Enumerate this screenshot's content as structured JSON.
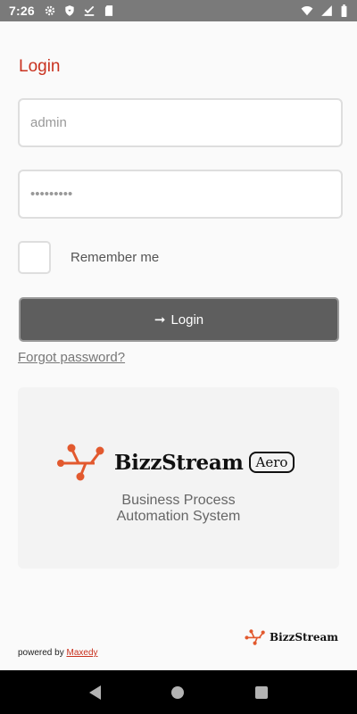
{
  "status_bar": {
    "time": "7:26",
    "left_icons": [
      "gear-icon",
      "shield-icon",
      "download-check-icon",
      "sd-card-icon"
    ],
    "right_icons": [
      "wifi-icon",
      "signal-icon",
      "battery-icon"
    ]
  },
  "login": {
    "title": "Login",
    "username_value": "admin",
    "password_value": "•••••••••",
    "remember_label": "Remember me",
    "button_label": "Login",
    "forgot_label": "Forgot password?"
  },
  "brand": {
    "name": "BizzStream",
    "badge": "Aero",
    "tagline_line1": "Business Process",
    "tagline_line2": "Automation System",
    "accent_color": "#e2592e"
  },
  "footer": {
    "brand_name": "BizzStream",
    "powered_by_prefix": "powered by",
    "powered_by_link": "Maxedy"
  },
  "colors": {
    "title": "#c9321f",
    "button_bg": "#5e5e5e",
    "statusbar_bg": "#7a7a7a"
  }
}
